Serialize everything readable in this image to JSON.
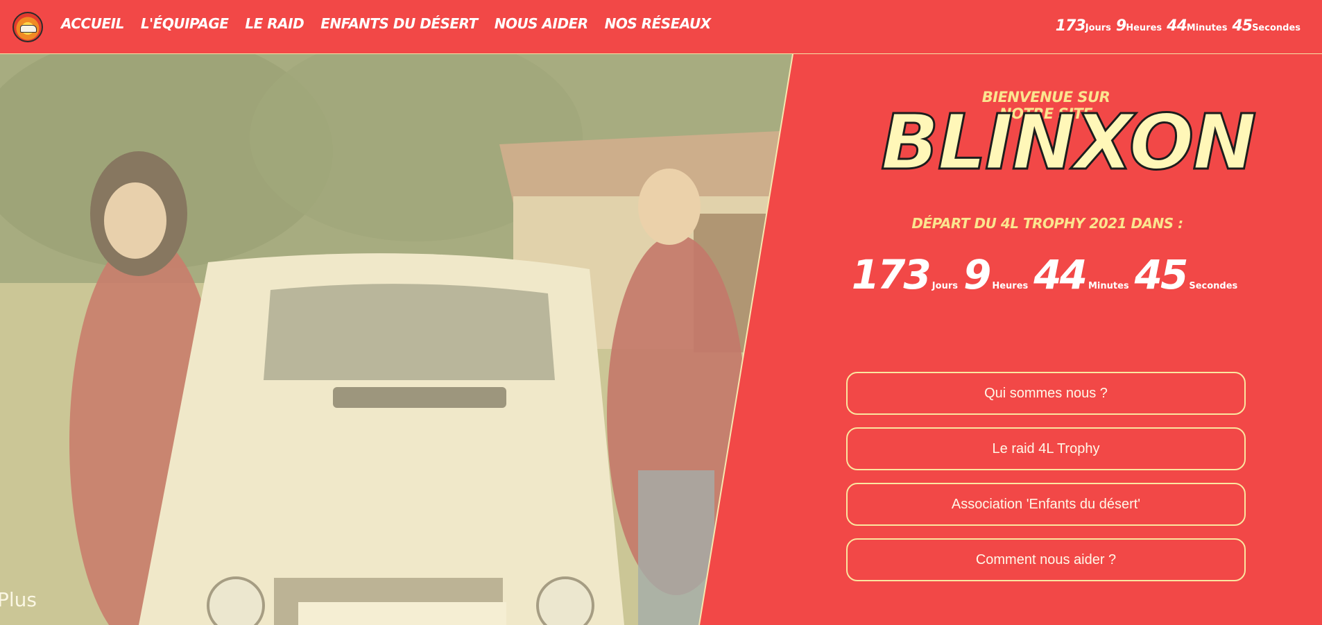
{
  "header": {
    "logo": "4L raid logo",
    "nav": [
      "ACCUEIL",
      "L'ÉQUIPAGE",
      "LE RAID",
      "ENFANTS DU DÉSERT",
      "NOUS AIDER",
      "NOS RÉSEAUX"
    ],
    "countdown": {
      "days": "173",
      "days_label": "Jours",
      "hours": "9",
      "hours_label": "Heures",
      "minutes": "44",
      "minutes_label": "Minutes",
      "seconds": "45",
      "seconds_label": "Secondes"
    }
  },
  "hero": {
    "photo_label": "Plus",
    "welcome": "BIENVENUE SUR NOTRE SITE",
    "brand": "BLINXON",
    "depart": "DÉPART DU 4L TROPHY 2021 DANS :",
    "countdown": {
      "days": "173",
      "days_label": "Jours",
      "hours": "9",
      "hours_label": "Heures",
      "minutes": "44",
      "minutes_label": "Minutes",
      "seconds": "45",
      "seconds_label": "Secondes"
    },
    "buttons": [
      "Qui sommes nous ?",
      "Le raid 4L Trophy",
      "Association 'Enfants du désert'",
      "Comment nous aider ?"
    ]
  },
  "colors": {
    "brand_red": "#f24847",
    "accent_cream": "#fbe58f",
    "outline": "#fbe6a0"
  }
}
